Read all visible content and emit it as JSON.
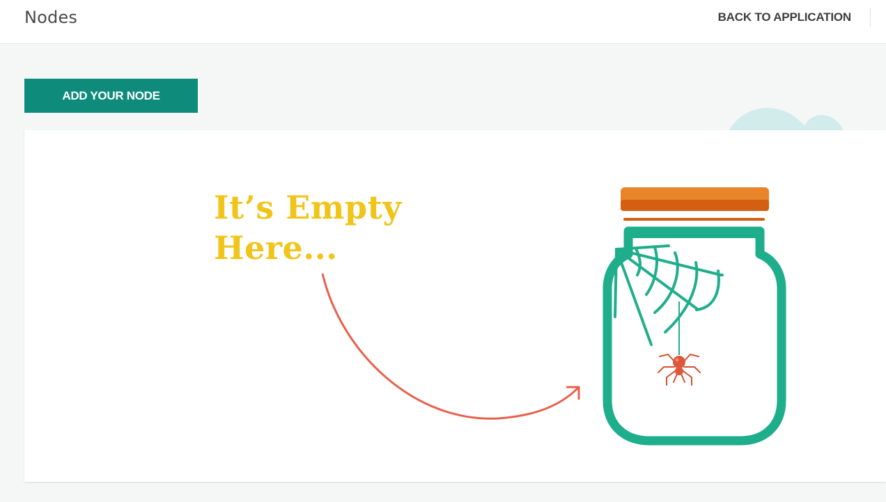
{
  "header": {
    "title": "Nodes",
    "back_link": "BACK TO APPLICATION"
  },
  "toolbar": {
    "add_node_label": "ADD YOUR NODE"
  },
  "empty_state": {
    "line1": "It’s Empty",
    "line2": "Here...",
    "illustration": "spider-jar-icon"
  },
  "colors": {
    "primary": "#0e8b7b",
    "title_yellow": "#f0c419",
    "arrow_red": "#e8604c",
    "jar_green": "#1fae8c",
    "lid_orange": "#d9681a",
    "cloud_blue": "#d2ebeb"
  }
}
